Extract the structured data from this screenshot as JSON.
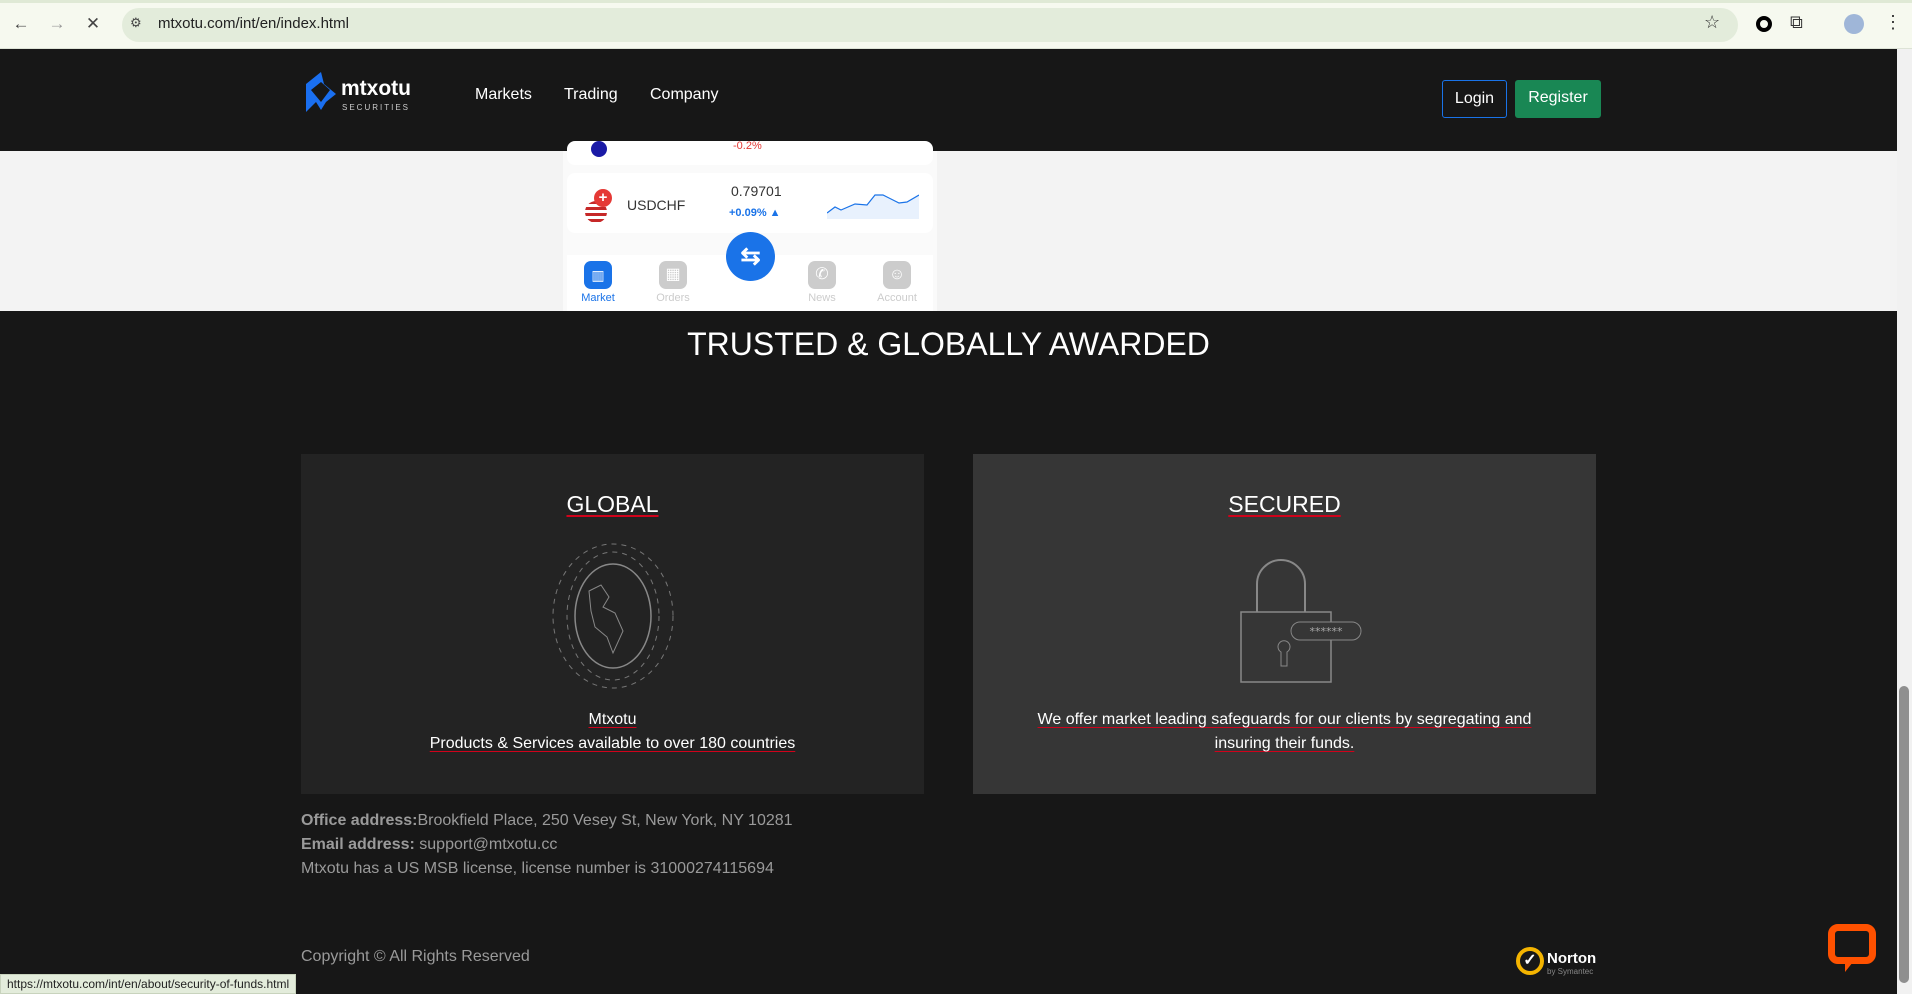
{
  "browser": {
    "url": "mtxotu.com/int/en/index.html",
    "status_url": "https://mtxotu.com/int/en/about/security-of-funds.html"
  },
  "nav": {
    "logo_name": "mtxotu",
    "logo_sub": "SECURITIES",
    "links": [
      "Markets",
      "Trading",
      "Company"
    ],
    "login": "Login",
    "register": "Register"
  },
  "phone": {
    "partial_change": "-0.2%",
    "symbol": "USDCHF",
    "price": "0.79701",
    "change": "+0.09%",
    "tabs": [
      "Market",
      "Orders",
      "News",
      "Account"
    ]
  },
  "section": {
    "title": "TRUSTED & GLOBALLY AWARDED",
    "global": {
      "heading": "GLOBAL",
      "line1": "Mtxotu",
      "line2": "Products & Services available to over 180 countries"
    },
    "secured": {
      "heading": "SECURED",
      "desc": "We offer market leading safeguards for our clients by segregating and insuring their funds.",
      "password_mask": "******"
    }
  },
  "footer": {
    "office_label": "Office address:",
    "office": "Brookfield Place, 250 Vesey St, New York, NY 10281",
    "email_label": "Email address:",
    "email": " support@mtxotu.cc",
    "license": "Mtxotu has a US MSB license, license number is 31000274115694",
    "copyright": "Copyright © All Rights Reserved",
    "norton": "Norton",
    "norton_sub": "by Symantec"
  },
  "colors": {
    "accent": "#1a73e8",
    "register": "#198754",
    "underline": "#d0021b",
    "chat": "#ff5100"
  }
}
